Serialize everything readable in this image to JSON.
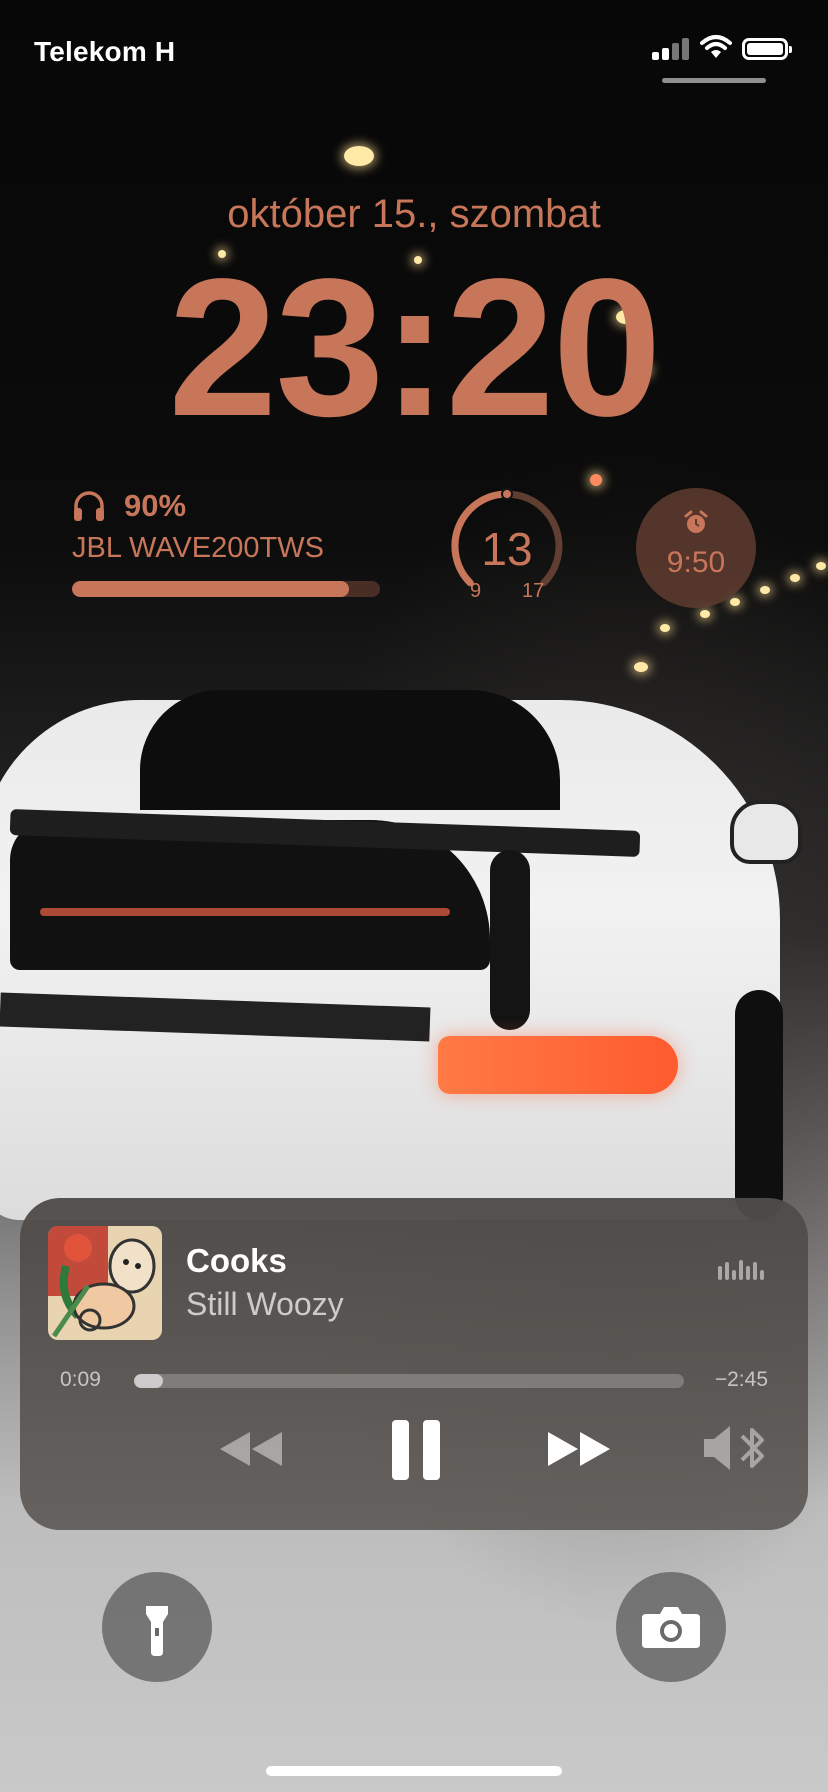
{
  "status_bar": {
    "carrier_main": "Telekom H",
    "carrier_fade": "",
    "signal_icon": "cellular-signal-icon",
    "wifi_icon": "wifi-icon",
    "battery_icon": "battery-icon"
  },
  "lock": {
    "date": "október 15., szombat",
    "time": "23:20"
  },
  "widgets": {
    "headphones": {
      "icon": "headphones-icon",
      "percent_label": "90%",
      "level": 0.9,
      "device": "JBL WAVE200TWS"
    },
    "gauge": {
      "value": "13",
      "min": "9",
      "max": "17"
    },
    "alarm": {
      "icon": "alarm-clock-icon",
      "time": "9:50"
    }
  },
  "now_playing": {
    "title": "Cooks",
    "artist": "Still Woozy",
    "elapsed": "0:09",
    "remaining": "−2:45",
    "progress": 0.052,
    "controls": {
      "rewind": "rewind-icon",
      "pause": "pause-icon",
      "forward": "fast-forward-icon",
      "route": "speaker-bluetooth-icon"
    }
  },
  "quick_actions": {
    "flashlight": "flashlight-icon",
    "camera": "camera-icon"
  },
  "colors": {
    "accent": "#c7765a"
  }
}
